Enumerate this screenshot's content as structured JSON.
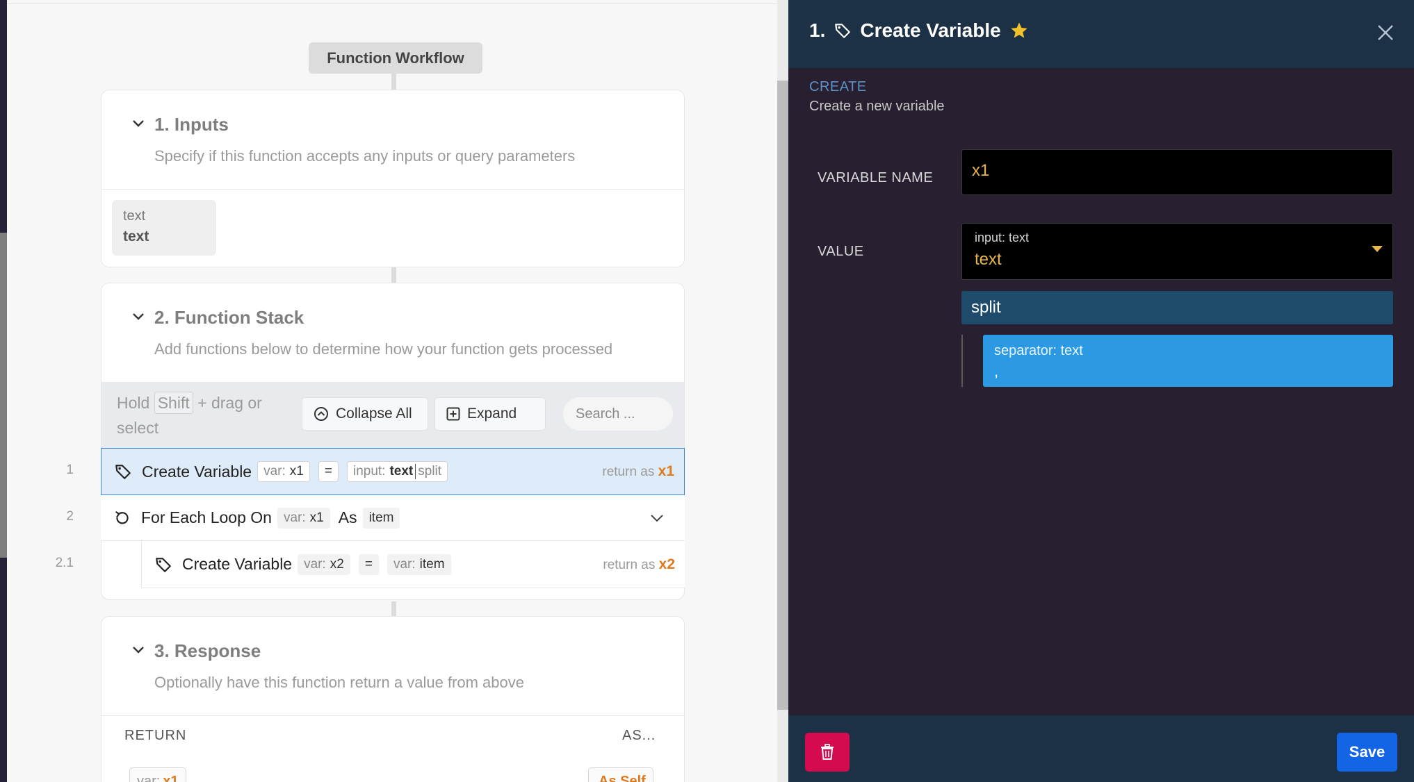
{
  "workflow": {
    "title": "Function Workflow",
    "inputs": {
      "title": "1. Inputs",
      "description": "Specify if this function accepts any inputs or query parameters",
      "items": [
        {
          "name": "text",
          "type": "text"
        }
      ]
    },
    "stack": {
      "title": "2. Function Stack",
      "description": "Add functions below to determine how your function gets processed",
      "hint_prefix": "Hold",
      "hint_key": "Shift",
      "hint_suffix": "+ drag or select",
      "collapse_all": "Collapse All",
      "expand": "Expand",
      "search_placeholder": "Search ...",
      "steps": [
        {
          "num": "1",
          "name": "Create Variable",
          "var_label": "var:",
          "var": "x1",
          "eq": "=",
          "value_label": "input:",
          "value": "text",
          "filter": "split",
          "returns_label": "return as",
          "returns": "x1"
        },
        {
          "num": "2",
          "name": "For Each Loop On",
          "var_label": "var:",
          "var": "x1",
          "as_label": "As",
          "item": "item"
        },
        {
          "num": "2.1",
          "name": "Create Variable",
          "var_label": "var:",
          "var": "x2",
          "eq": "=",
          "value_label": "var:",
          "value": "item",
          "returns_label": "return as",
          "returns": "x2"
        }
      ]
    },
    "response": {
      "title": "3. Response",
      "description": "Optionally have this function return a value from above",
      "return_col": "RETURN",
      "as_col": "AS...",
      "value_label": "var:",
      "value": "x1",
      "as_value": "As Self"
    }
  },
  "panel": {
    "num": "1.",
    "title": "Create Variable",
    "subhead": "CREATE",
    "subdesc": "Create a new variable",
    "variable_name_label": "VARIABLE NAME",
    "variable_name": "x1",
    "value_label": "VALUE",
    "value_type": "input: text",
    "value": "text",
    "filter": "split",
    "param_label": "separator: text",
    "param_value": ",",
    "save": "Save",
    "colors": {
      "header": "#1c3046",
      "body": "#282030",
      "accent": "#e6b84c",
      "filter": "#1e4a6b",
      "param": "#2c9ae3",
      "delete": "#d40b4e",
      "save": "#1465e6"
    }
  }
}
